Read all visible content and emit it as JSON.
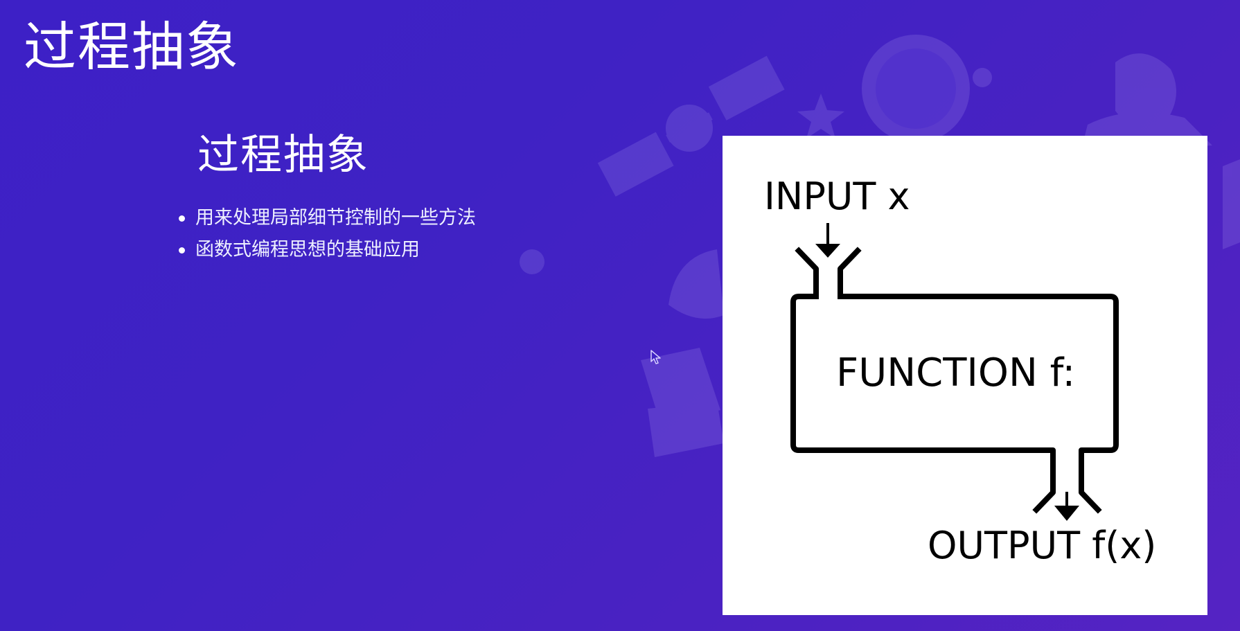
{
  "slide": {
    "title": "过程抽象",
    "heading": "过程抽象",
    "bullets": [
      "用来处理局部细节控制的一些方法",
      "函数式编程思想的基础应用"
    ]
  },
  "diagram": {
    "input_label": "INPUT x",
    "function_label": "FUNCTION f:",
    "output_label": "OUTPUT f(x)"
  },
  "colors": {
    "background_start": "#3d20c6",
    "background_end": "#5523c3",
    "card": "#ffffff",
    "diagram_stroke": "#000000"
  },
  "icons": {
    "background_illustration": "astronaut-satellite-illustration",
    "pointer": "mouse-cursor-icon"
  }
}
